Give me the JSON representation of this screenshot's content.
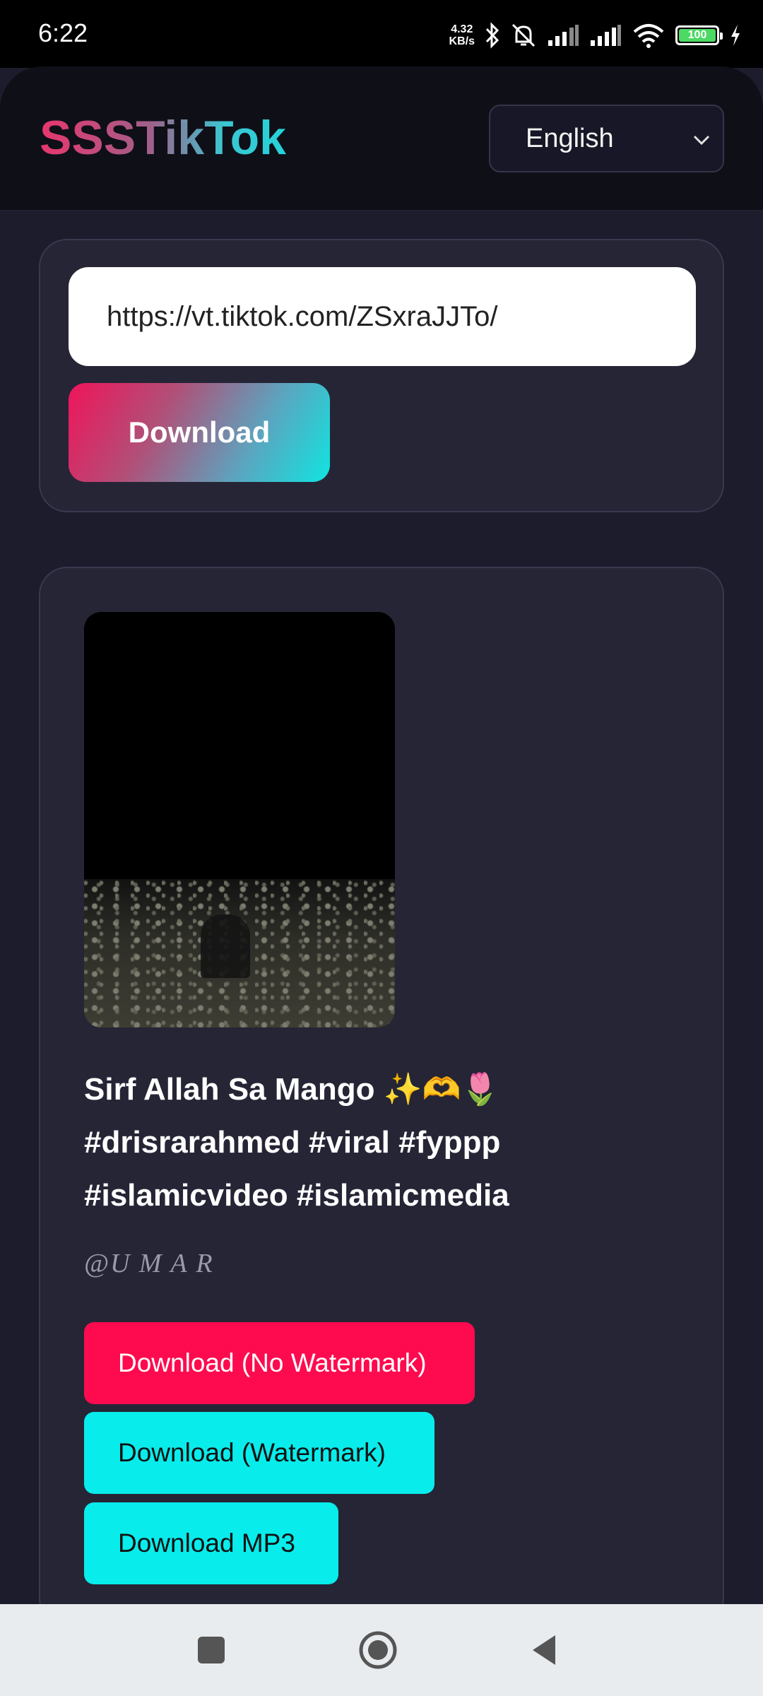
{
  "status_bar": {
    "time": "6:22",
    "net_speed_value": "4.32",
    "net_speed_unit": "KB/s",
    "battery": "100",
    "icons": [
      "bluetooth-icon",
      "bell-off-icon",
      "signal-icon",
      "signal-icon",
      "wifi-icon",
      "battery-icon",
      "charging-icon"
    ]
  },
  "header": {
    "logo": "SSSTikTok",
    "language": "English"
  },
  "url_form": {
    "url_value": "https://vt.tiktok.com/ZSxraJJTo/",
    "download_label": "Download"
  },
  "result": {
    "caption_line1": "Sirf Allah Sa Mango ✨🫶🌷",
    "caption_line2": "#drisrarahmed #viral #fyppp",
    "caption_line3": "#islamicvideo #islamicmedia",
    "author": "@U   M   A   R",
    "btn_no_watermark": "Download (No Watermark)",
    "btn_watermark": "Download (Watermark)",
    "btn_mp3": "Download MP3"
  },
  "colors": {
    "background": "#1c1c2c",
    "card": "#252536",
    "pink": "#fe0b4f",
    "cyan": "#08ecec"
  }
}
